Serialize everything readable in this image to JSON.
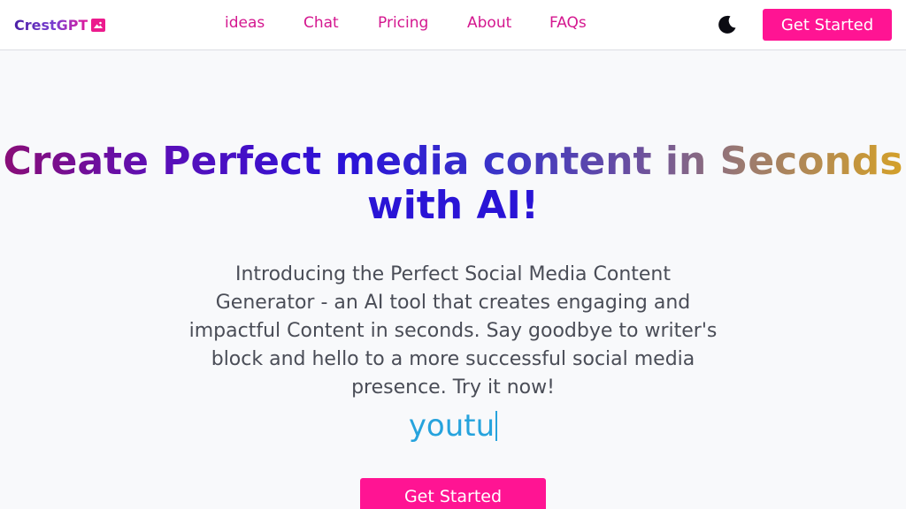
{
  "brand": {
    "name": "CrestGPT",
    "icon": "image-icon",
    "accent": "#ff1493"
  },
  "nav": {
    "links": [
      "ideas",
      "Chat",
      "Pricing",
      "About",
      "FAQs"
    ],
    "theme_toggle_icon": "moon-icon",
    "cta_label": "Get Started"
  },
  "hero": {
    "title_line1": "Create Perfect media content in Seconds",
    "title_line2": "with AI!",
    "description": "Introducing the Perfect Social Media Content Generator - an AI tool that creates engaging and impactful Content in seconds. Say goodbye to writer's block and hello to a more successful social media presence. Try it now!",
    "typed_text": "youtu",
    "cta_label": "Get Started"
  }
}
